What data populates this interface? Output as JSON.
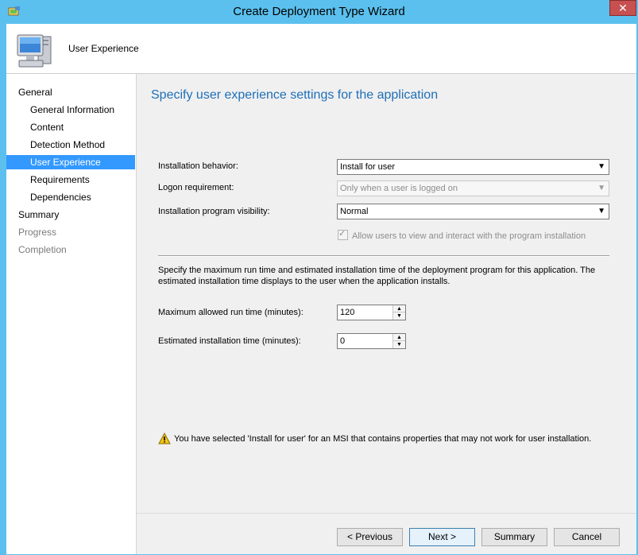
{
  "window": {
    "title": "Create Deployment Type Wizard",
    "close_label": "✕"
  },
  "header": {
    "title": "User Experience"
  },
  "sidebar": {
    "items": [
      {
        "label": "General",
        "state": "normal",
        "level": "top"
      },
      {
        "label": "General Information",
        "state": "normal",
        "level": "sub"
      },
      {
        "label": "Content",
        "state": "normal",
        "level": "sub"
      },
      {
        "label": "Detection Method",
        "state": "normal",
        "level": "sub"
      },
      {
        "label": "User Experience",
        "state": "selected",
        "level": "sub"
      },
      {
        "label": "Requirements",
        "state": "normal",
        "level": "sub"
      },
      {
        "label": "Dependencies",
        "state": "normal",
        "level": "sub"
      },
      {
        "label": "Summary",
        "state": "normal",
        "level": "top"
      },
      {
        "label": "Progress",
        "state": "disabled",
        "level": "top"
      },
      {
        "label": "Completion",
        "state": "disabled",
        "level": "top"
      }
    ]
  },
  "main": {
    "heading": "Specify user experience settings for the application",
    "installation_behavior": {
      "label": "Installation behavior:",
      "value": "Install for user"
    },
    "logon_requirement": {
      "label": "Logon requirement:",
      "value": "Only when a user is logged on"
    },
    "program_visibility": {
      "label": "Installation program visibility:",
      "value": "Normal"
    },
    "allow_interact": {
      "label": "Allow users to view and interact with the program installation",
      "checked": true
    },
    "description": "Specify the maximum run time and estimated installation time of the deployment program for this application. The estimated installation time displays to the user when the application installs.",
    "max_run_time": {
      "label": "Maximum allowed run time (minutes):",
      "value": "120"
    },
    "est_install_time": {
      "label": "Estimated installation time (minutes):",
      "value": "0"
    },
    "warning": "You have selected 'Install for user' for an MSI that contains properties that may not work for user installation."
  },
  "footer": {
    "previous_label": "< Previous",
    "next_label": "Next >",
    "summary_label": "Summary",
    "cancel_label": "Cancel"
  },
  "colors": {
    "titlebar": "#5bc0ee",
    "selection": "#3399ff",
    "heading": "#1e6fb8",
    "close": "#c75050"
  }
}
